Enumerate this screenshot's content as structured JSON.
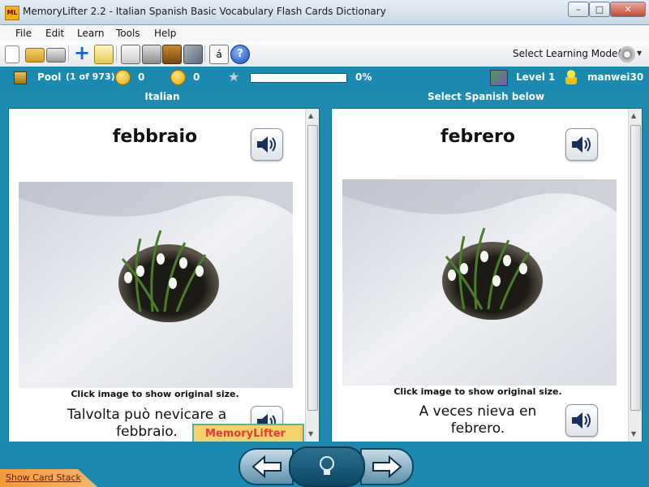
{
  "window": {
    "title": "MemoryLifter 2.2 - Italian Spanish Basic Vocabulary Flash Cards Dictionary",
    "app_icon": "ML"
  },
  "menu": [
    "File",
    "Edit",
    "Learn",
    "Tools",
    "Help"
  ],
  "toolbar": {
    "icons": [
      "new-file-icon",
      "open-folder-icon",
      "print-icon",
      "add-card-icon",
      "edit-card-icon",
      "slideshow-icon",
      "card-drawer-icon",
      "notebook-icon",
      "tools-icon",
      "special-character-icon",
      "help-icon"
    ],
    "mode_label": "Select Learning Mode(s)"
  },
  "status": {
    "pool_label": "Pool",
    "pool_count": "(1 of 973)",
    "correct_count": "0",
    "wrong_count": "0",
    "progress_percent": "0%",
    "progress_value": 0,
    "level": "Level 1",
    "user": "manwei30"
  },
  "columns": {
    "left_header": "Italian",
    "right_header": "Select Spanish below"
  },
  "left_card": {
    "word": "febbraio",
    "hint": "Click image to show original size.",
    "sentence_line1": "Talvolta può nevicare a",
    "sentence_line2": "febbraio."
  },
  "right_card": {
    "word": "febrero",
    "hint": "Click image to show original size.",
    "sentence_line1": "A veces nieva en",
    "sentence_line2": "febrero."
  },
  "logo_badge": "MemoryLifter",
  "bottom": {
    "show_stack": "Show Card Stack"
  },
  "colors": {
    "accent": "#1a8ab0",
    "panel_border": "#0d6e92",
    "stack_tab": "#f39a3a"
  }
}
